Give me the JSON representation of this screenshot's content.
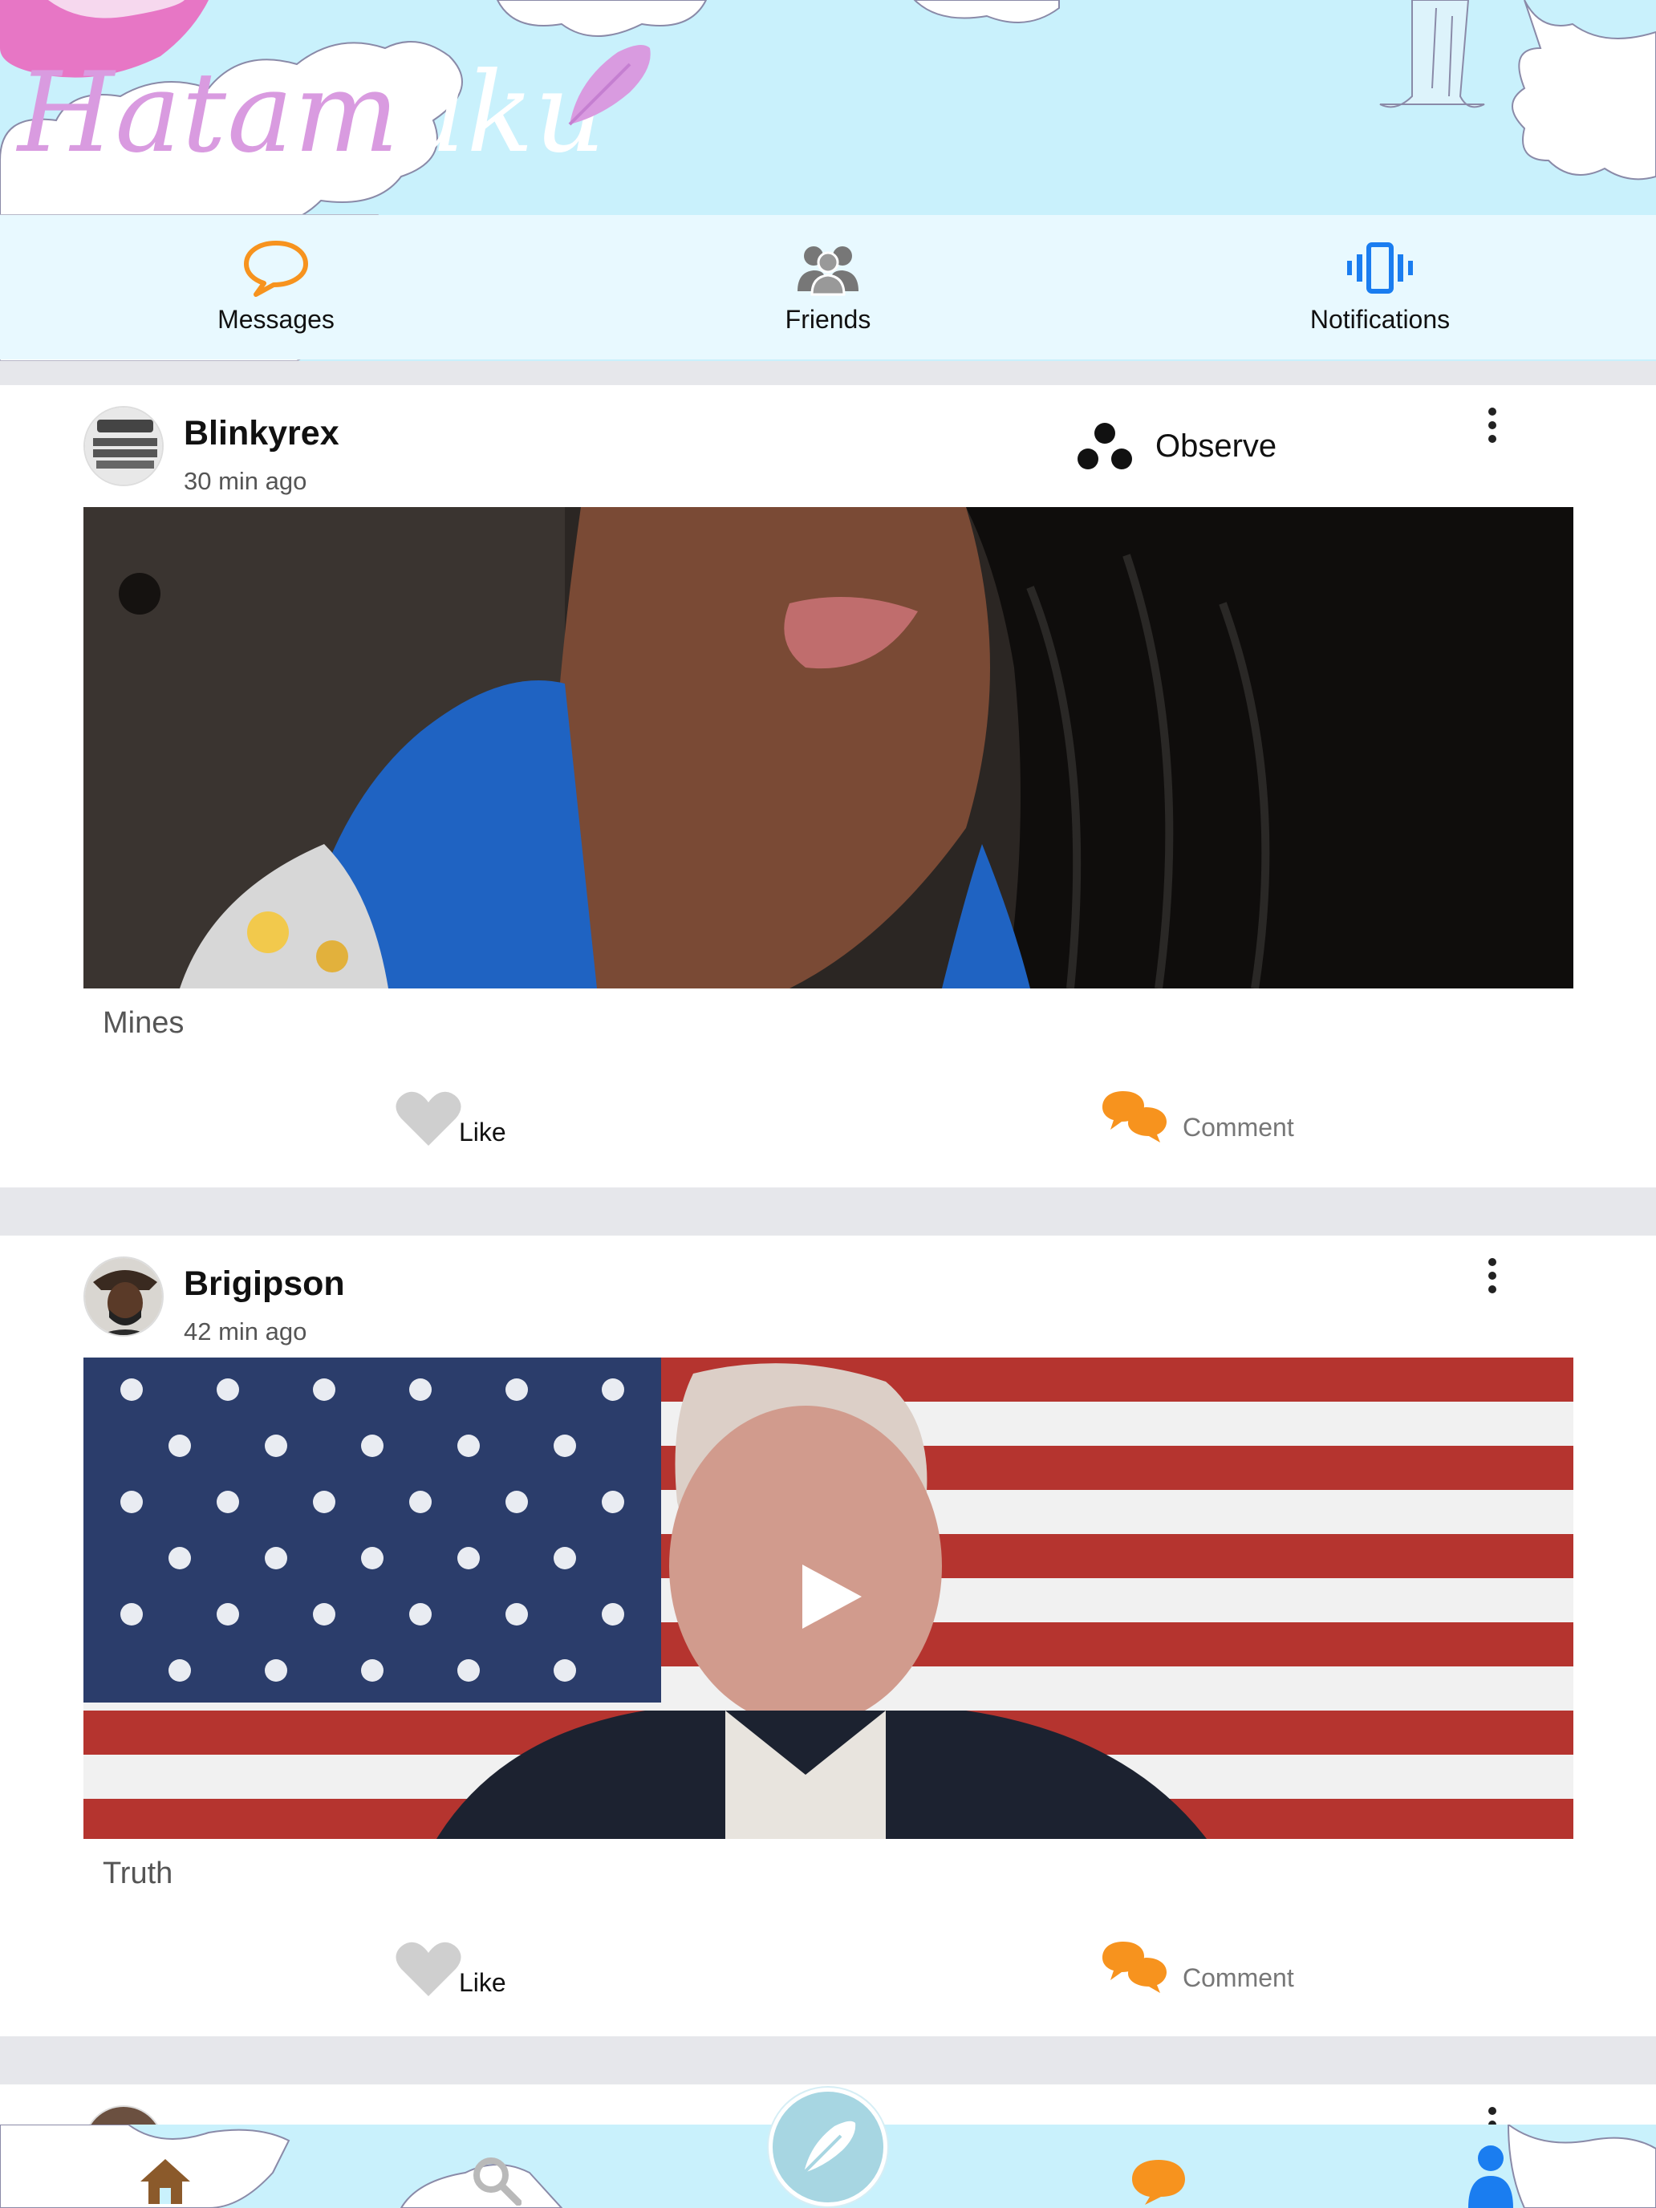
{
  "app": {
    "logo_parts": [
      "Hata",
      "m",
      "a",
      "ku"
    ],
    "colors": {
      "orange": "#f7931e",
      "blue": "#1a7df0",
      "sky": "#c9f1fc",
      "feed_bg": "#e6e7eb"
    }
  },
  "topnav": {
    "tabs": [
      {
        "label": "Messages",
        "icon": "chat-bubble-icon"
      },
      {
        "label": "Friends",
        "icon": "friends-icon"
      },
      {
        "label": "Notifications",
        "icon": "vibrate-phone-icon"
      }
    ]
  },
  "posts": [
    {
      "username": "Blinkyrex",
      "time": "30 min ago",
      "observe_label": "Observe",
      "caption": "Mines",
      "like_label": "Like",
      "comment_label": "Comment",
      "media_type": "photo"
    },
    {
      "username": "Brigipson",
      "time": "42 min ago",
      "caption": "Truth",
      "like_label": "Like",
      "comment_label": "Comment",
      "media_type": "video"
    }
  ],
  "bottomnav": {
    "items": [
      "home-icon",
      "search-icon",
      "compose-feather-icon",
      "chat-icon",
      "profile-icon"
    ]
  }
}
